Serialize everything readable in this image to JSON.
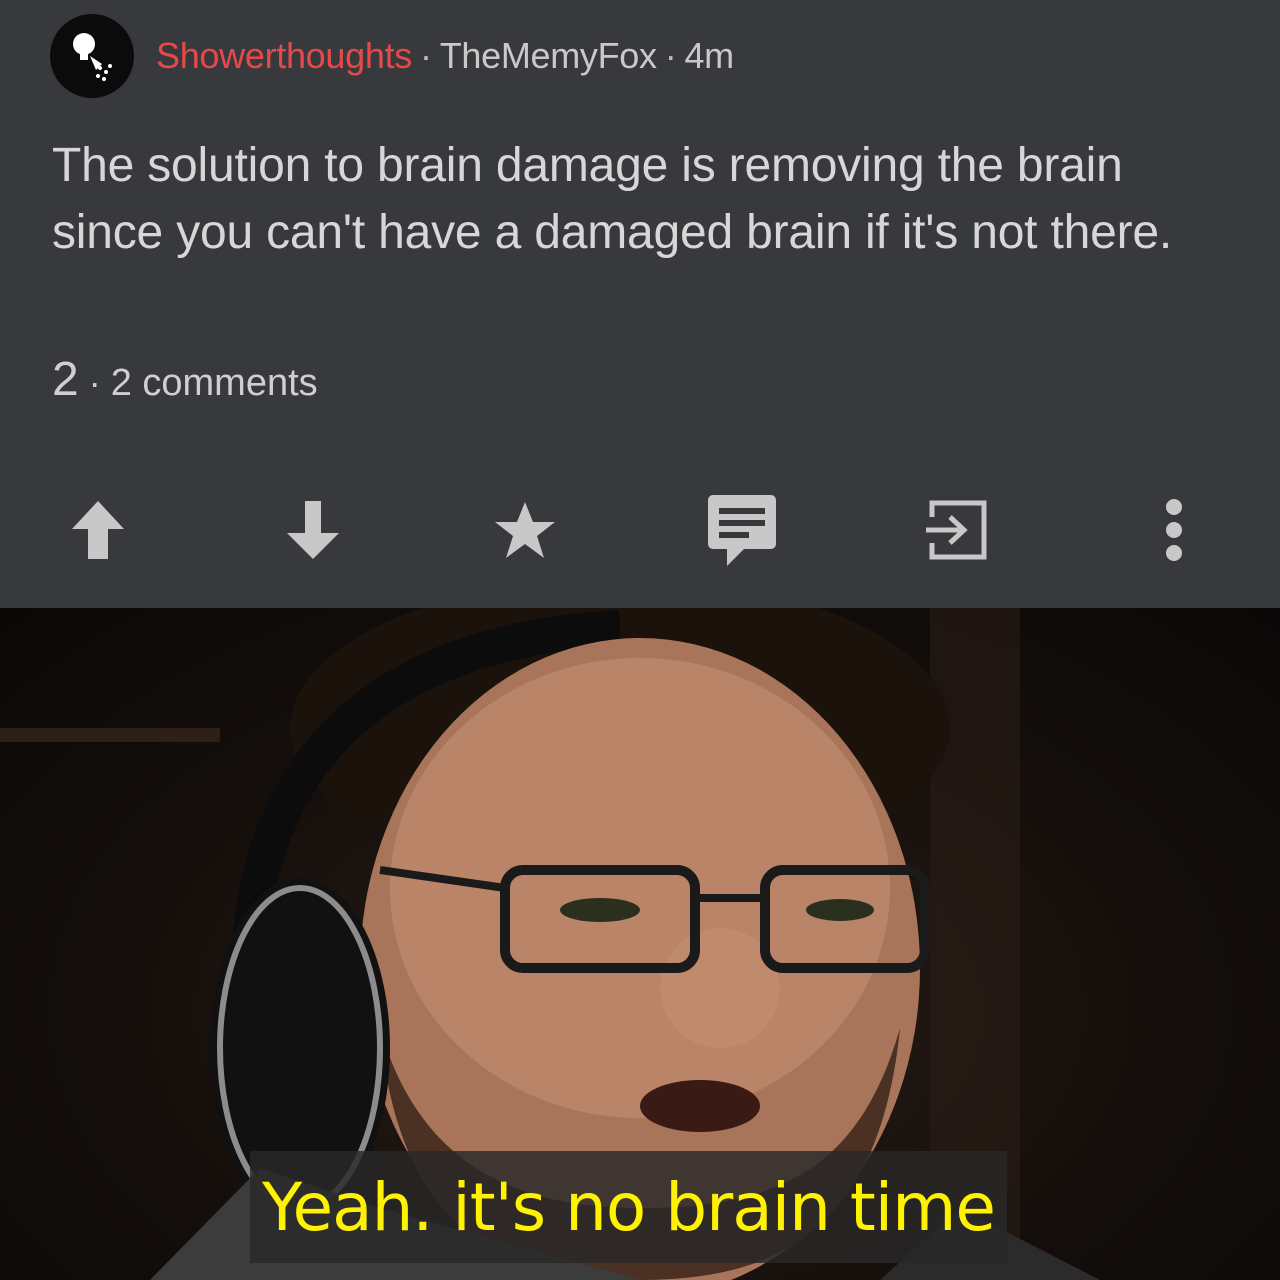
{
  "post": {
    "subreddit": "Showerthoughts",
    "separator": "·",
    "author": "TheMemyFox",
    "age": "4m",
    "title": "The solution to brain damage is removing the brain since you can't have a damaged brain if it's not there.",
    "score": "2",
    "comments": "2 comments",
    "subreddit_icon": "shower-lightbulb-icon",
    "colors": {
      "background": "#38393d",
      "subreddit": "#e8484a",
      "text": "#d7d7d7",
      "icons": "#c8c8c8"
    }
  },
  "actions": [
    {
      "name": "upvote",
      "icon": "arrow-up-icon"
    },
    {
      "name": "downvote",
      "icon": "arrow-down-icon"
    },
    {
      "name": "save",
      "icon": "star-icon"
    },
    {
      "name": "comments",
      "icon": "comment-icon"
    },
    {
      "name": "share",
      "icon": "share-exit-icon"
    },
    {
      "name": "more",
      "icon": "more-vertical-icon"
    }
  ],
  "video_frame": {
    "subtitle": "Yeah. it's no brain time",
    "subtitle_color": "#fff200"
  }
}
